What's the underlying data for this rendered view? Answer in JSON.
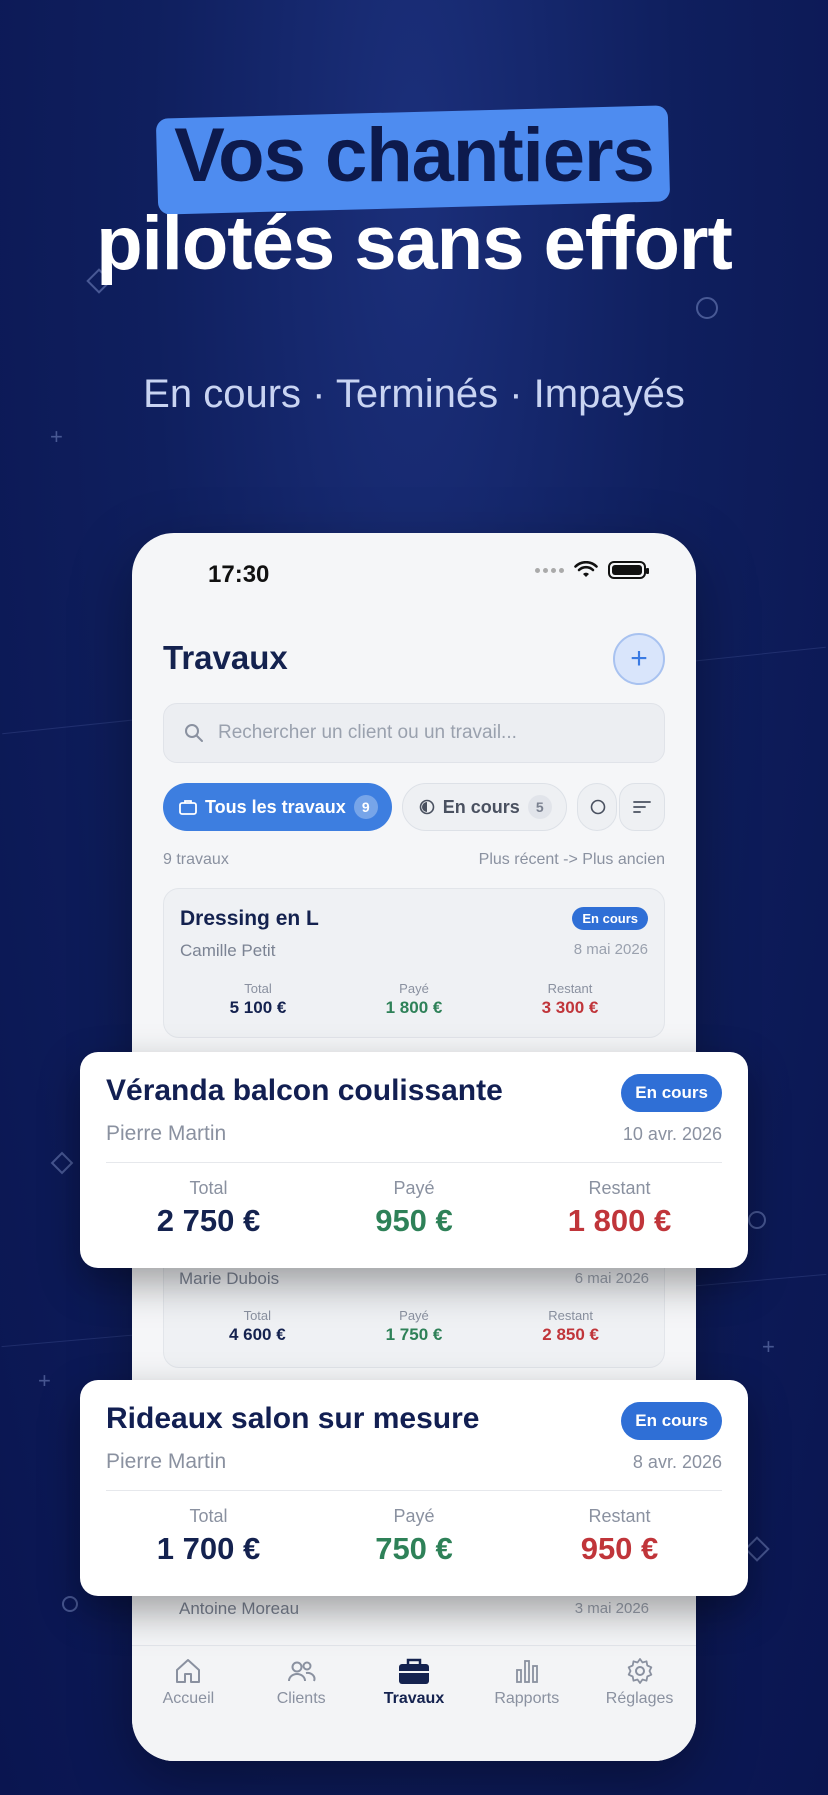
{
  "hero": {
    "line1": "Vos chantiers",
    "line2": "pilotés sans effort",
    "subtitle": "En cours · Terminés · Impayés"
  },
  "status_bar": {
    "time": "17:30"
  },
  "header": {
    "title": "Travaux",
    "add_icon": "plus-icon"
  },
  "search": {
    "placeholder": "Rechercher un client ou un travail..."
  },
  "filters": [
    {
      "label": "Tous les travaux",
      "count": "9",
      "active": true
    },
    {
      "label": "En cours",
      "count": "5",
      "active": false
    }
  ],
  "list_meta": {
    "count_label": "9 travaux",
    "sort_label": "Plus récent -> Plus ancien"
  },
  "jobs": [
    {
      "title": "Dressing en L",
      "client": "Camille Petit",
      "date": "8 mai 2026",
      "status": "En cours",
      "total": "5 100 €",
      "paid": "1 800 €",
      "rest": "3 300 €"
    },
    {
      "client": "Marie Dubois",
      "date": "6 mai 2026",
      "total": "4 600 €",
      "paid": "1 750 €",
      "rest": "2 850 €"
    },
    {
      "client": "Antoine Moreau",
      "date": "3 mai 2026"
    }
  ],
  "labels": {
    "total": "Total",
    "paid": "Payé",
    "rest": "Restant"
  },
  "featured": [
    {
      "title": "Véranda balcon coulissante",
      "client": "Pierre Martin",
      "date": "10 avr. 2026",
      "status": "En cours",
      "total": "2 750 €",
      "paid": "950 €",
      "rest": "1 800 €"
    },
    {
      "title": "Rideaux salon sur mesure",
      "client": "Pierre Martin",
      "date": "8 avr. 2026",
      "status": "En cours",
      "total": "1 700 €",
      "paid": "750 €",
      "rest": "950 €"
    }
  ],
  "tabbar": [
    {
      "label": "Accueil",
      "icon": "home-icon"
    },
    {
      "label": "Clients",
      "icon": "users-icon"
    },
    {
      "label": "Travaux",
      "icon": "briefcase-icon",
      "active": true
    },
    {
      "label": "Rapports",
      "icon": "chart-icon"
    },
    {
      "label": "Réglages",
      "icon": "gear-icon"
    }
  ],
  "colors": {
    "accent": "#3d7ee0",
    "paid": "#2e8158",
    "rest": "#c0353a",
    "navy": "#14224f"
  }
}
